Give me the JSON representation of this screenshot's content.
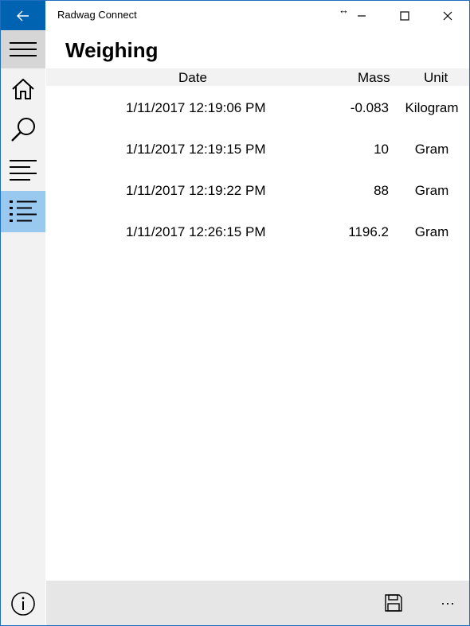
{
  "window": {
    "title": "Radwag Connect",
    "drag_glyph": "↔"
  },
  "icons": {
    "back": "back-arrow-icon",
    "minimize": "minimize-icon",
    "maximize": "maximize-icon",
    "close": "close-icon",
    "hamburger": "hamburger-menu-icon",
    "home": "home-icon",
    "search": "search-icon",
    "lines": "align-left-icon",
    "list": "bulleted-list-icon",
    "info": "info-icon",
    "save": "save-icon",
    "more": "more-icon"
  },
  "colors": {
    "accent": "#0063b1",
    "active_nav": "#99c9ef",
    "sidebar_bg": "#f2f2f2",
    "bottombar_bg": "#e6e6e6"
  },
  "page": {
    "title": "Weighing"
  },
  "table": {
    "columns": [
      "Date",
      "Mass",
      "Unit"
    ],
    "rows": [
      {
        "date": "1/11/2017 12:19:06 PM",
        "mass": "-0.083",
        "unit": "Kilogram"
      },
      {
        "date": "1/11/2017 12:19:15 PM",
        "mass": "10",
        "unit": "Gram"
      },
      {
        "date": "1/11/2017 12:19:22 PM",
        "mass": "88",
        "unit": "Gram"
      },
      {
        "date": "1/11/2017 12:26:15 PM",
        "mass": "1196.2",
        "unit": "Gram"
      }
    ]
  },
  "bottombar": {
    "more_label": "···"
  }
}
